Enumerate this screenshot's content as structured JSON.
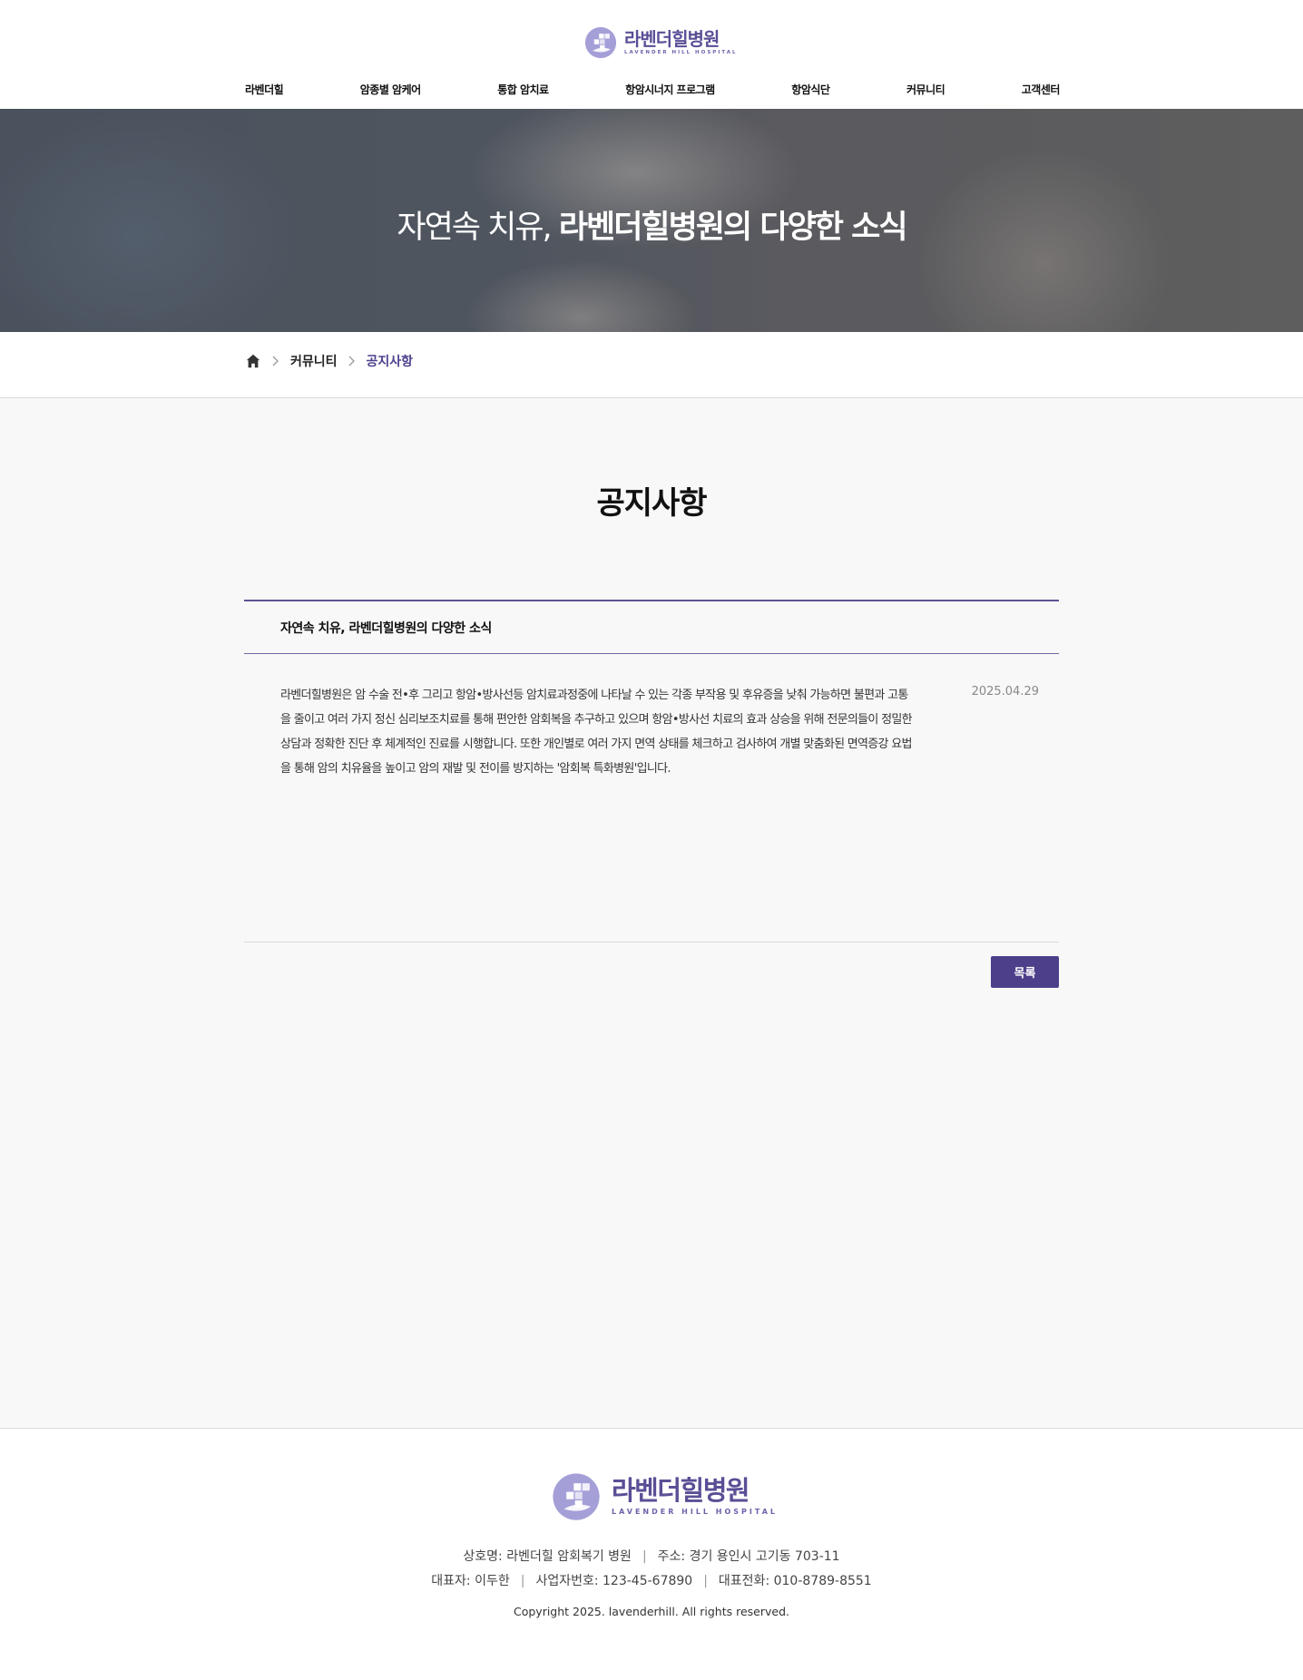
{
  "brand": {
    "name": "라벤더힐병원",
    "name_en": "LAVENDER HILL HOSPITAL",
    "primary_color": "#5a4f96",
    "accent_color": "#a59fd8"
  },
  "nav": {
    "items": [
      {
        "label": "라벤더힐"
      },
      {
        "label": "암종별 암케어"
      },
      {
        "label": "통합 암치료"
      },
      {
        "label": "항암시너지 프로그램"
      },
      {
        "label": "항암식단"
      },
      {
        "label": "커뮤니티"
      },
      {
        "label": "고객센터"
      }
    ]
  },
  "hero": {
    "title_light": "자연속 치유,",
    "title_bold": "라벤더힐병원의 다양한 소식"
  },
  "breadcrumb": {
    "home_icon": "home-icon",
    "items": [
      {
        "label": "커뮤니티"
      },
      {
        "label": "공지사항"
      }
    ]
  },
  "page": {
    "title": "공지사항"
  },
  "post": {
    "subject": "자연속 치유, 라벤더힐병원의 다양한 소식",
    "date": "2025.04.29",
    "body": "라벤더힐병원은 암 수술 전•후 그리고 항암•방사선등 암치료과정중에 나타날 수 있는 각종 부작용 및 후유증을 낮춰 가능하면 불편과 고통을 줄이고 여러 가지 정신 심리보조치료를 통해 편안한 암회복을 추구하고 있으며 항암•방사선 치료의 효과 상승을 위해 전문의들이 정밀한 상담과 정확한 진단 후 체계적인 진료를 시행합니다. 또한 개인별로 여러 가지 면역 상태를 체크하고 검사하여 개별 맞춤화된 면역증강 요법을 통해 암의 치유율을 높이고 암의 재발 및 전이를 방지하는 '암회복 특화병원'입니다.",
    "list_button": "목록"
  },
  "footer": {
    "company_label": "상호명: 라벤더힐 암회복기 병원",
    "address_label": "주소: 경기 용인시 고기동 703-11",
    "ceo_label": "대표자: 이두한",
    "bizno_label": "사업자번호: 123-45-67890",
    "phone_label": "대표전화: 010-8789-8551",
    "separator": "|",
    "copyright": "Copyright 2025. lavenderhill. All rights reserved."
  }
}
